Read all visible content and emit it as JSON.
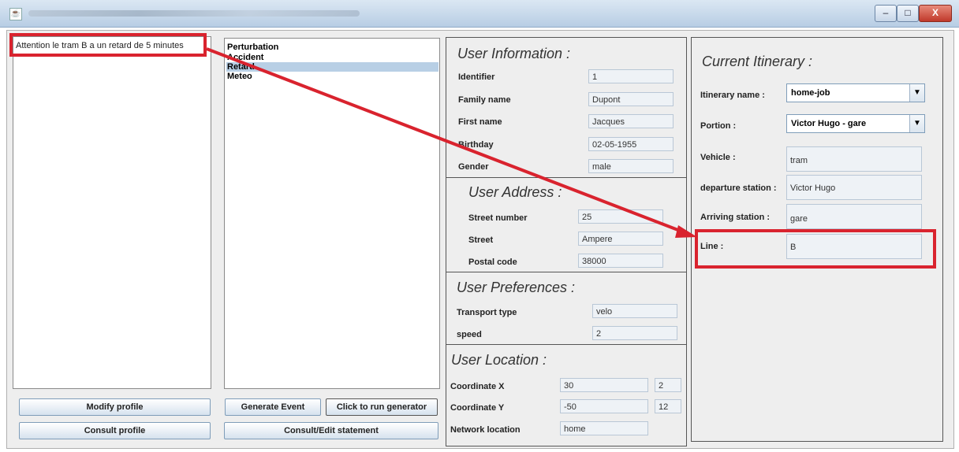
{
  "window": {
    "icon": "java-app-icon",
    "minimize": "–",
    "maximize": "□",
    "close": "X"
  },
  "messages": {
    "items": [
      "Attention le tram B a un retard de 5 minutes"
    ]
  },
  "events": {
    "items": [
      "Perturbation",
      "Accident",
      "Retard",
      "Meteo"
    ],
    "selected": "Retard"
  },
  "buttons": {
    "modify_profile": "Modify profile",
    "consult_profile": "Consult profile",
    "generate_event": "Generate Event",
    "run_generator": "Click to run generator",
    "consult_statement": "Consult/Edit statement"
  },
  "user_info": {
    "title": "User Information :",
    "identifier_label": "Identifier",
    "identifier": "1",
    "family_label": "Family name",
    "family": "Dupont",
    "first_label": "First name",
    "first": "Jacques",
    "birthday_label": "Birthday",
    "birthday": "02-05-1955",
    "gender_label": "Gender",
    "gender": "male"
  },
  "address": {
    "title": "User Address :",
    "street_number_label": "Street number",
    "street_number": "25",
    "street_label": "Street",
    "street": "Ampere",
    "postal_label": "Postal code",
    "postal": "38000"
  },
  "preferences": {
    "title": "User Preferences :",
    "transport_label": "Transport type",
    "transport": "velo",
    "speed_label": "speed",
    "speed": "2"
  },
  "location": {
    "title": "User Location :",
    "x_label": "Coordinate X",
    "x_value": "30",
    "x_extra": "2",
    "y_label": "Coordinate Y",
    "y_value": "-50",
    "y_extra": "12",
    "network_label": "Network location",
    "network": "home"
  },
  "itinerary": {
    "title": "Current Itinerary :",
    "name_label": "Itinerary name :",
    "name": "home-job",
    "portion_label": "Portion :",
    "portion": "Victor Hugo - gare",
    "vehicle_label": "Vehicle :",
    "vehicle": "tram",
    "departure_label": "departure station :",
    "departure": "Victor Hugo",
    "arriving_label": "Arriving station :",
    "arriving": "gare",
    "line_label": "Line :",
    "line": "B"
  },
  "annotation_color": "#d9232e"
}
